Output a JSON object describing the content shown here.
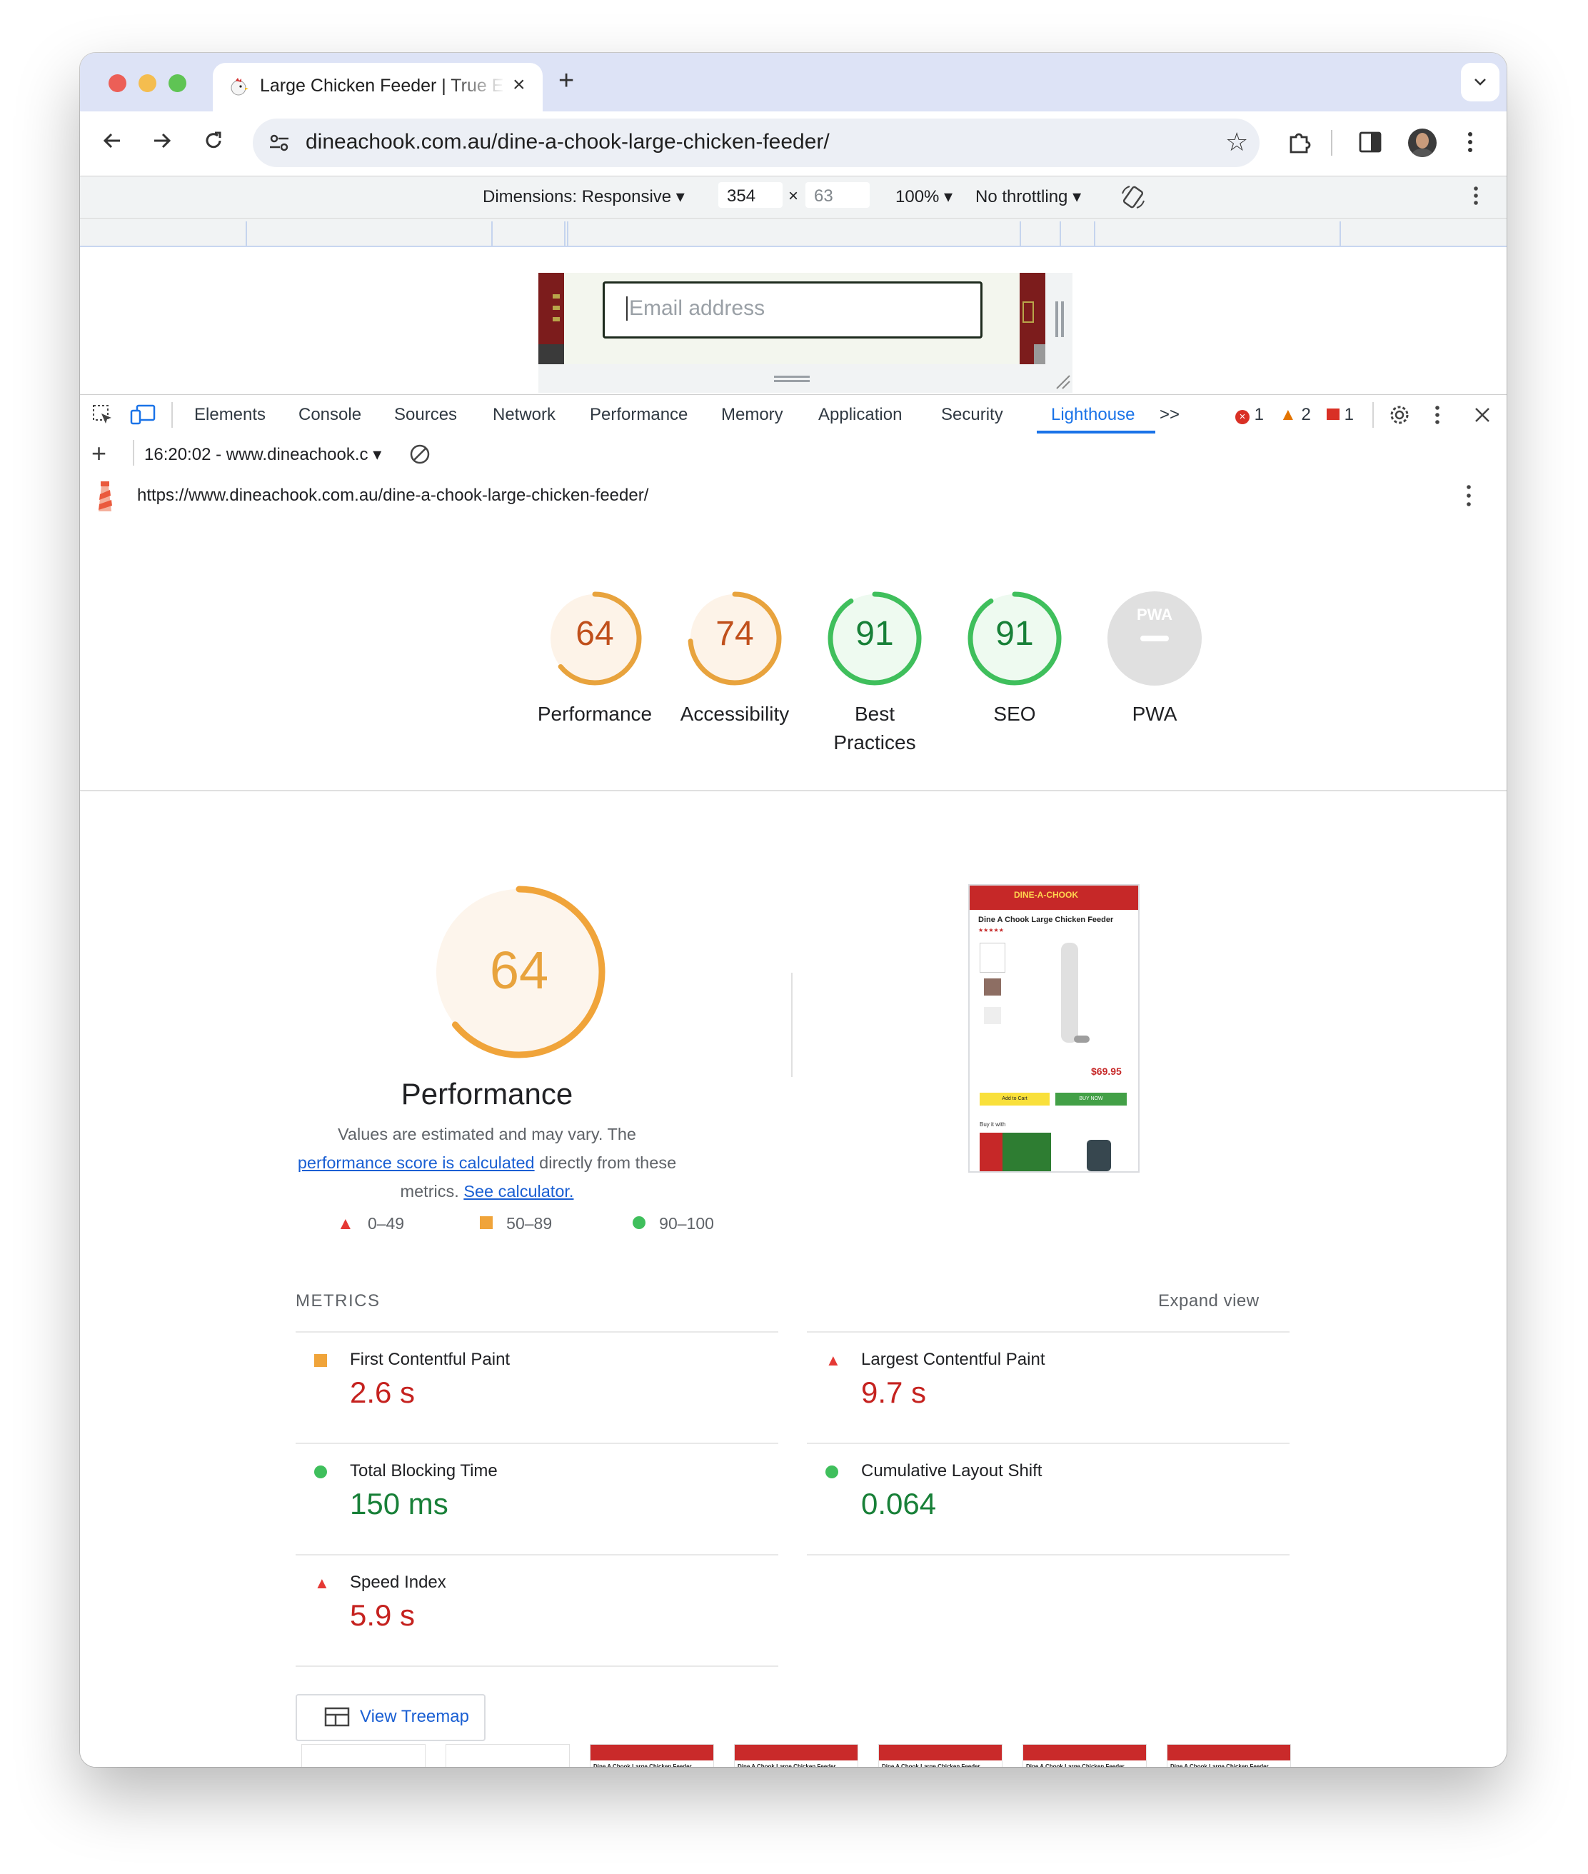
{
  "browser": {
    "tab_title": "Large Chicken Feeder | True E",
    "url": "dineachook.com.au/dine-a-chook-large-chicken-feeder/"
  },
  "device_toolbar": {
    "dimensions_label": "Dimensions: Responsive",
    "width": "354",
    "times": "×",
    "height": "63",
    "zoom": "100%",
    "throttling": "No throttling"
  },
  "viewport_page": {
    "email_placeholder": "Email address"
  },
  "devtools": {
    "tabs": [
      "Elements",
      "Console",
      "Sources",
      "Network",
      "Performance",
      "Memory",
      "Application",
      "Security",
      "Lighthouse"
    ],
    "active_tab": "Lighthouse",
    "more": ">>",
    "error_count": "1",
    "warning_count": "2",
    "issue_count": "1",
    "report_selector": "16:20:02 - www.dineachook.c",
    "report_url": "https://www.dineachook.com.au/dine-a-chook-large-chicken-feeder/"
  },
  "scores": [
    {
      "label": "Performance",
      "value": "64",
      "score": 64,
      "color": "#e8a33d",
      "text_color": "#c0501c"
    },
    {
      "label": "Accessibility",
      "value": "74",
      "score": 74,
      "color": "#e8a33d",
      "text_color": "#c0501c"
    },
    {
      "label": "Best Practices",
      "value": "91",
      "score": 91,
      "color": "#3fbf5c",
      "text_color": "#188038"
    },
    {
      "label": "SEO",
      "value": "91",
      "score": 91,
      "color": "#3fbf5c",
      "text_color": "#188038"
    },
    {
      "label": "PWA",
      "value": "PWA",
      "score": null,
      "color": "#e0e0e0",
      "text_color": "#ffffff"
    }
  ],
  "performance": {
    "score": "64",
    "title": "Performance",
    "desc_prefix": "Values are estimated and may vary. The ",
    "desc_link": "performance score is calculated",
    "desc_middle": " directly from these metrics. ",
    "desc_link2": "See calculator.",
    "legend": [
      "0–49",
      "50–89",
      "90–100"
    ]
  },
  "preview": {
    "brand": "DINE-A-CHOOK",
    "product_title": "Dine A Chook Large Chicken Feeder",
    "price": "$69.95",
    "add_to_cart": "Add to Cart",
    "buy_now": "BUY NOW",
    "buy_it_with": "Buy it with"
  },
  "metrics": {
    "heading": "METRICS",
    "expand": "Expand view",
    "items": [
      {
        "name": "First Contentful Paint",
        "value": "2.6 s",
        "status": "average"
      },
      {
        "name": "Largest Contentful Paint",
        "value": "9.7 s",
        "status": "fail"
      },
      {
        "name": "Total Blocking Time",
        "value": "150 ms",
        "status": "pass"
      },
      {
        "name": "Cumulative Layout Shift",
        "value": "0.064",
        "status": "pass"
      },
      {
        "name": "Speed Index",
        "value": "5.9 s",
        "status": "fail"
      }
    ]
  },
  "treemap_button": "View Treemap",
  "filmstrip_title": "Dine A Chook Large Chicken Feeder"
}
